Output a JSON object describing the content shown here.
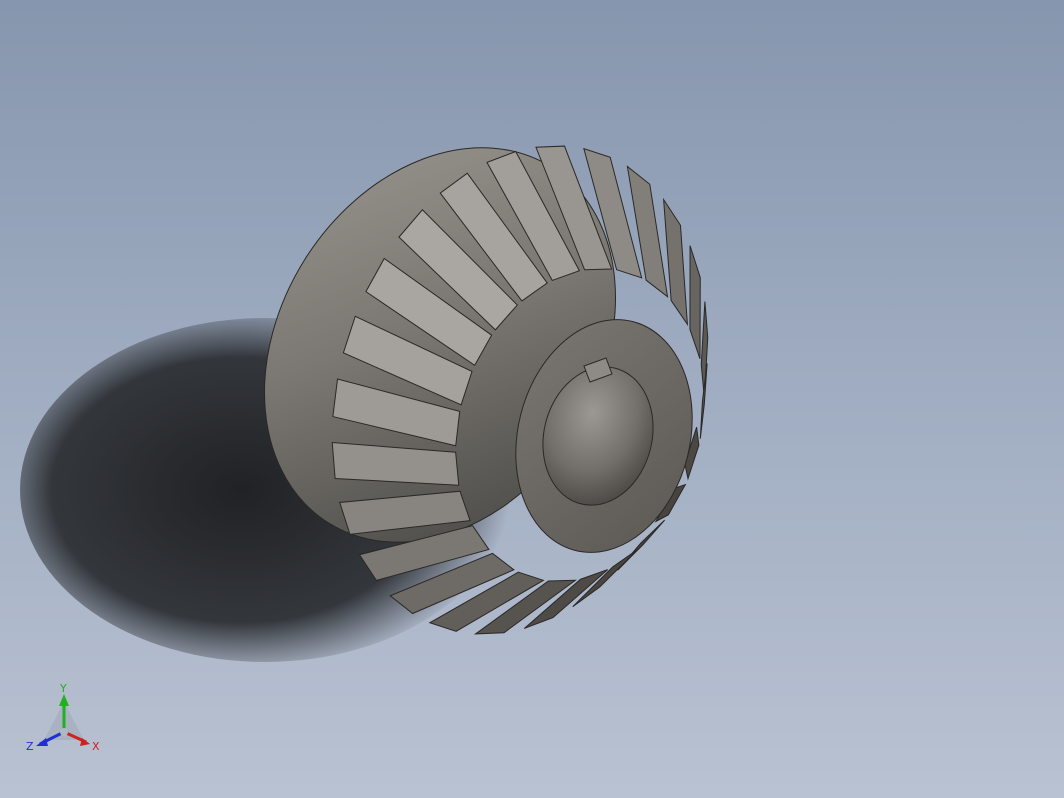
{
  "viewport": {
    "background_top": "#8696ae",
    "background_bottom": "#b9c2d2"
  },
  "model": {
    "part": "bevel-gear",
    "teeth": 24,
    "bore_keyway": true,
    "body_color": "#807c76",
    "shadow_color": "#2a2c2f"
  },
  "triad": {
    "x_label": "X",
    "y_label": "Y",
    "z_label": "Z",
    "x_color": "#d02020",
    "y_color": "#20b020",
    "z_color": "#2030d0"
  }
}
